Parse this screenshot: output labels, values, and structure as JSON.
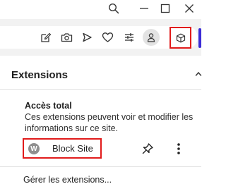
{
  "window_controls": {
    "icons": [
      "search-icon",
      "minimize-icon",
      "maximize-icon",
      "close-icon"
    ]
  },
  "toolbar": {
    "icons": [
      "edit-icon",
      "camera-icon",
      "send-icon",
      "heart-icon",
      "sliders-icon",
      "profile-icon",
      "extensions-icon"
    ],
    "colors": {
      "highlight": "#e11b1b",
      "accent": "#3b2bd6"
    }
  },
  "popup": {
    "title": "Extensions",
    "full_access": {
      "heading": "Accès total",
      "description": "Ces extensions peuvent voir et modifier les informations sur ce site."
    },
    "extension": {
      "avatar_letter": "W",
      "name": "Block Site"
    },
    "manage_label": "Gérer les extensions..."
  }
}
